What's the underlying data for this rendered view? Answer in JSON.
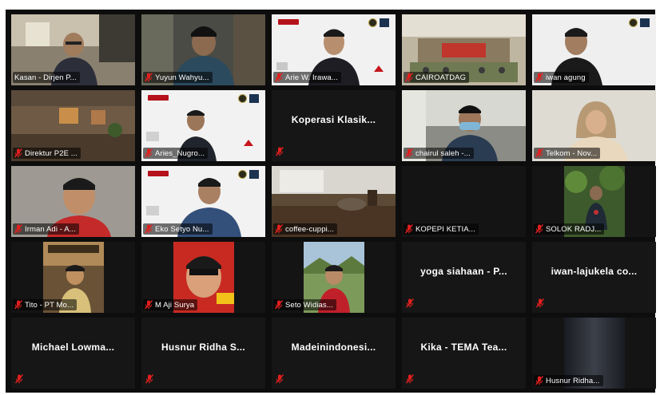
{
  "gallery": {
    "participants": [
      {
        "name": "Kasan - Dirjen P...",
        "active": true
      },
      {
        "name": "Yuyun Wahyu..."
      },
      {
        "name": "Arie W. Irawa..."
      },
      {
        "name": "CAIROATDAG"
      },
      {
        "name": "iwan agung"
      },
      {
        "name": "Direktur P2E ..."
      },
      {
        "name": "Aries_Nugro..."
      },
      {
        "name": "Koperasi Klasik...",
        "video_off": true
      },
      {
        "name": "chairul saleh -..."
      },
      {
        "name": "Telkom - Nov..."
      },
      {
        "name": "Irman Adi - A..."
      },
      {
        "name": "Eko Setyo Nu..."
      },
      {
        "name": "coffee-cuppi..."
      },
      {
        "name": "KOPEPI KETIA..."
      },
      {
        "name": "SOLOK RADJ..."
      },
      {
        "name": "Tito - PT Mo..."
      },
      {
        "name": "M Aji Surya"
      },
      {
        "name": "Seto Widias..."
      },
      {
        "name": "yoga siahaan - P...",
        "video_off": true
      },
      {
        "name": "iwan-lajukela co...",
        "video_off": true
      },
      {
        "name": "Michael Lowma...",
        "video_off": true
      },
      {
        "name": "Husnur Ridha S...",
        "video_off": true
      },
      {
        "name": "Madeinindonesi...",
        "video_off": true
      },
      {
        "name": "Kika - TEMA Tea...",
        "video_off": true
      },
      {
        "name": "Husnur Ridha..."
      }
    ]
  },
  "icons": {
    "mute": "muted-microphone-icon"
  },
  "colors": {
    "active_speaker_border": "#e7e23a",
    "muted_icon": "#e0201e",
    "gallery_background": "#0d0d0d"
  }
}
